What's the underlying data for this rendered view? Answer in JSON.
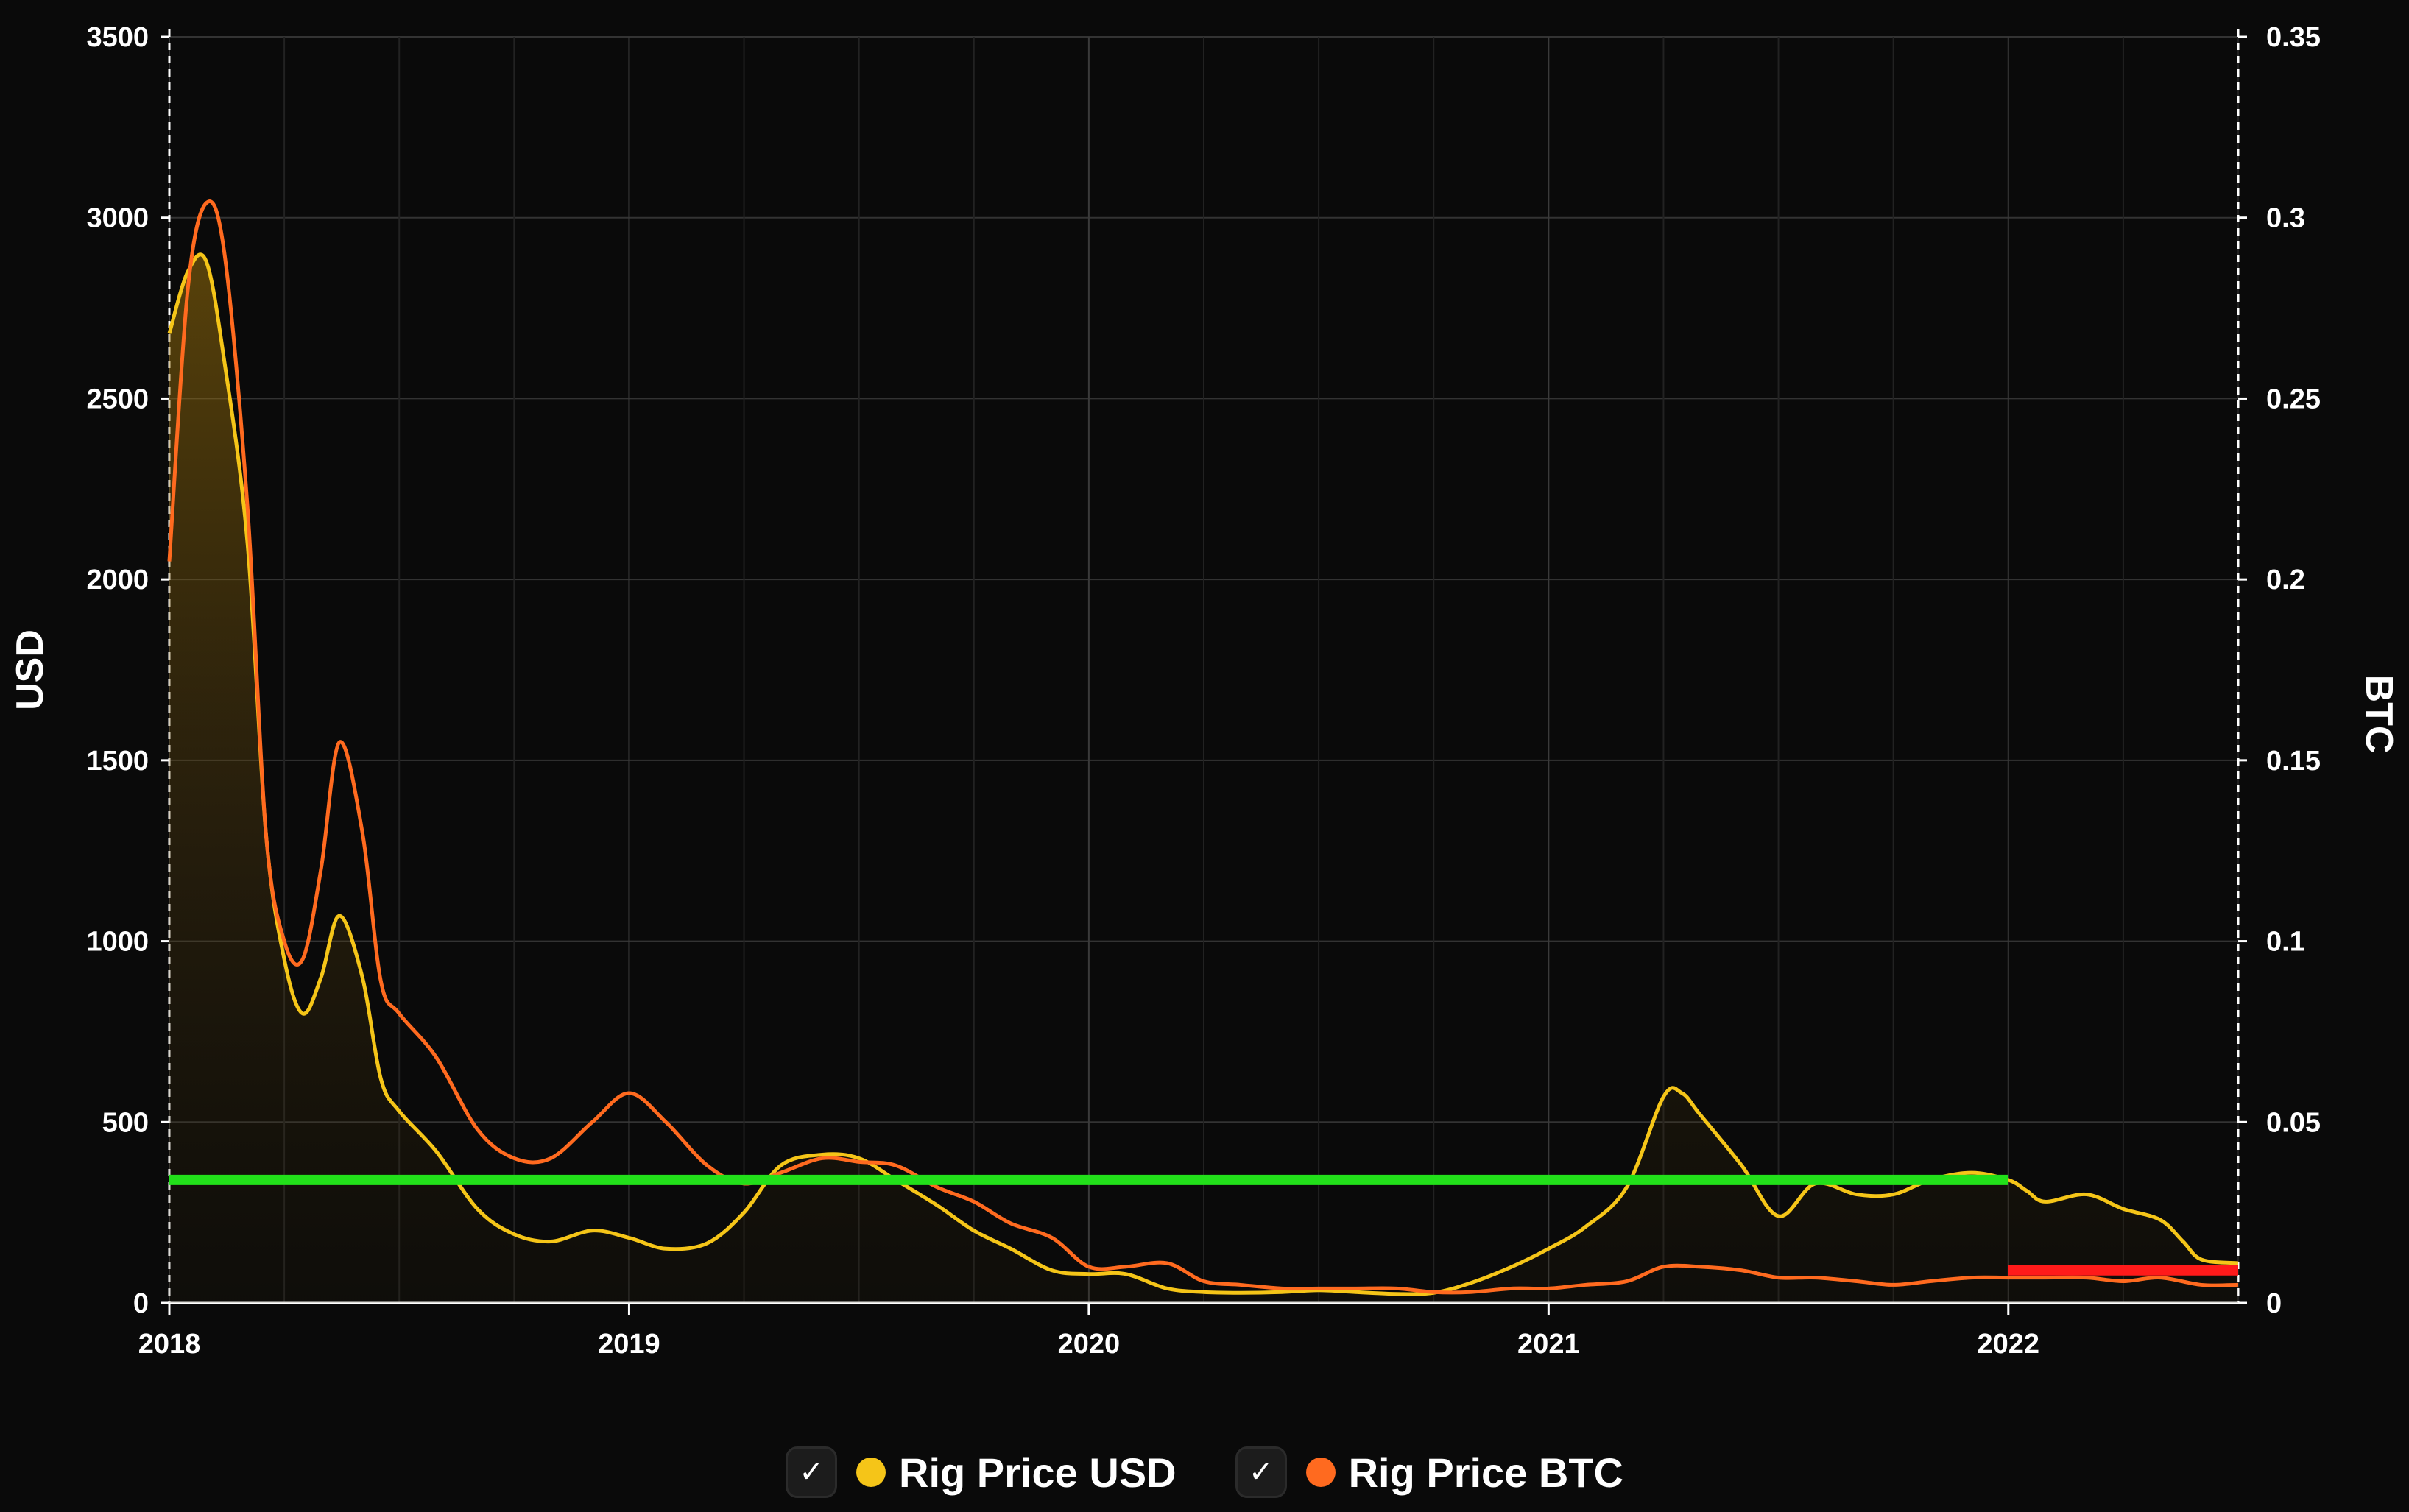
{
  "chart_data": {
    "type": "line",
    "title": "",
    "xlabel": "",
    "x_ticks": [
      "2018",
      "2019",
      "2020",
      "2021",
      "2022"
    ],
    "x_range": [
      2018.0,
      2022.5
    ],
    "y_left": {
      "label": "USD",
      "range": [
        0,
        3500
      ],
      "ticks": [
        "0",
        "500",
        "1000",
        "1500",
        "2000",
        "2500",
        "3000",
        "3500"
      ]
    },
    "y_right": {
      "label": "BTC",
      "range": [
        0,
        0.35
      ],
      "ticks": [
        "0",
        "0.05",
        "0.1",
        "0.15",
        "0.2",
        "0.25",
        "0.3",
        "0.35"
      ]
    },
    "grid": true,
    "legend_position": "bottom-center",
    "series": [
      {
        "name": "Rig Price USD",
        "axis": "left",
        "color": "#f5c518",
        "fill": true,
        "x": [
          2018.0,
          2018.04,
          2018.08,
          2018.12,
          2018.17,
          2018.21,
          2018.25,
          2018.29,
          2018.33,
          2018.37,
          2018.42,
          2018.46,
          2018.5,
          2018.58,
          2018.67,
          2018.75,
          2018.83,
          2018.92,
          2019.0,
          2019.08,
          2019.17,
          2019.25,
          2019.33,
          2019.42,
          2019.5,
          2019.58,
          2019.67,
          2019.75,
          2019.83,
          2019.92,
          2020.0,
          2020.08,
          2020.17,
          2020.25,
          2020.33,
          2020.42,
          2020.5,
          2020.58,
          2020.67,
          2020.75,
          2020.83,
          2020.92,
          2021.0,
          2021.08,
          2021.17,
          2021.25,
          2021.29,
          2021.33,
          2021.42,
          2021.5,
          2021.58,
          2021.67,
          2021.75,
          2021.83,
          2021.92,
          2022.0,
          2022.04,
          2022.08,
          2022.17,
          2022.25,
          2022.33,
          2022.38,
          2022.42,
          2022.5
        ],
        "values": [
          2680,
          2850,
          2880,
          2600,
          2100,
          1300,
          950,
          800,
          900,
          1070,
          900,
          620,
          530,
          420,
          260,
          190,
          170,
          200,
          180,
          150,
          165,
          250,
          380,
          410,
          400,
          340,
          270,
          200,
          150,
          90,
          80,
          80,
          40,
          30,
          28,
          30,
          35,
          30,
          25,
          28,
          55,
          100,
          150,
          210,
          320,
          570,
          580,
          520,
          380,
          240,
          330,
          300,
          300,
          340,
          360,
          340,
          310,
          280,
          300,
          260,
          230,
          170,
          120,
          110
        ]
      },
      {
        "name": "Rig Price BTC",
        "axis": "right",
        "color": "#ff6a1f",
        "fill": false,
        "x": [
          2018.0,
          2018.04,
          2018.08,
          2018.12,
          2018.17,
          2018.21,
          2018.25,
          2018.29,
          2018.33,
          2018.37,
          2018.42,
          2018.46,
          2018.5,
          2018.58,
          2018.67,
          2018.75,
          2018.83,
          2018.92,
          2019.0,
          2019.08,
          2019.17,
          2019.25,
          2019.33,
          2019.42,
          2019.5,
          2019.58,
          2019.67,
          2019.75,
          2019.83,
          2019.92,
          2020.0,
          2020.08,
          2020.17,
          2020.25,
          2020.33,
          2020.42,
          2020.5,
          2020.58,
          2020.67,
          2020.75,
          2020.83,
          2020.92,
          2021.0,
          2021.08,
          2021.17,
          2021.25,
          2021.33,
          2021.42,
          2021.5,
          2021.58,
          2021.67,
          2021.75,
          2021.83,
          2021.92,
          2022.0,
          2022.08,
          2022.17,
          2022.25,
          2022.33,
          2022.42,
          2022.5
        ],
        "values": [
          0.205,
          0.28,
          0.304,
          0.29,
          0.22,
          0.13,
          0.1,
          0.095,
          0.12,
          0.155,
          0.13,
          0.089,
          0.08,
          0.068,
          0.048,
          0.04,
          0.04,
          0.05,
          0.058,
          0.05,
          0.038,
          0.033,
          0.036,
          0.04,
          0.039,
          0.038,
          0.032,
          0.028,
          0.022,
          0.018,
          0.01,
          0.01,
          0.011,
          0.006,
          0.005,
          0.004,
          0.004,
          0.004,
          0.004,
          0.003,
          0.003,
          0.004,
          0.004,
          0.005,
          0.006,
          0.01,
          0.01,
          0.009,
          0.007,
          0.007,
          0.006,
          0.005,
          0.006,
          0.007,
          0.007,
          0.007,
          0.007,
          0.006,
          0.007,
          0.005,
          0.005
        ]
      }
    ],
    "annotations": [
      {
        "type": "hline",
        "axis": "left",
        "y": 340,
        "x_from": 2018.0,
        "x_to": 2022.0,
        "color": "#22e01a"
      },
      {
        "type": "hline",
        "axis": "left",
        "y": 90,
        "x_from": 2022.0,
        "x_to": 2022.5,
        "color": "#ff1a1a"
      }
    ]
  },
  "legend": {
    "items": [
      {
        "label": "Rig Price USD",
        "color": "#f5c518",
        "checkmark": "✓"
      },
      {
        "label": "Rig Price BTC",
        "color": "#ff6a1f",
        "checkmark": "✓"
      }
    ]
  }
}
